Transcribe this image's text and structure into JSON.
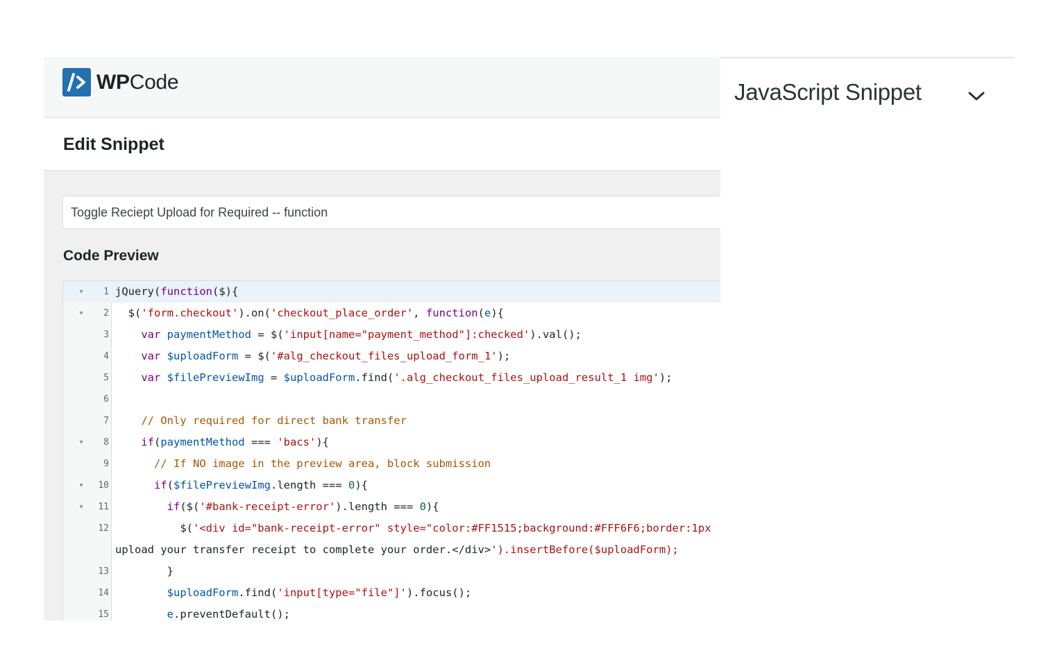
{
  "brand": {
    "name_bold": "WP",
    "name_regular": "Code",
    "accent": "#2271b1"
  },
  "header": {
    "page_title": "Edit Snippet"
  },
  "snippet": {
    "title_value": "Toggle Reciept Upload for Required -- function"
  },
  "code_preview": {
    "label": "Code Preview",
    "lines": [
      {
        "n": "1",
        "fold": "▾",
        "text": "jQuery(function($){"
      },
      {
        "n": "2",
        "fold": "▾",
        "text": "  $('form.checkout').on('checkout_place_order', function(e){"
      },
      {
        "n": "3",
        "fold": "",
        "text": "    var paymentMethod = $('input[name=\"payment_method\"]:checked').val();"
      },
      {
        "n": "4",
        "fold": "",
        "text": "    var $uploadForm = $('#alg_checkout_files_upload_form_1');"
      },
      {
        "n": "5",
        "fold": "",
        "text": "    var $filePreviewImg = $uploadForm.find('.alg_checkout_files_upload_result_1 img');"
      },
      {
        "n": "6",
        "fold": "",
        "text": ""
      },
      {
        "n": "7",
        "fold": "",
        "text": "    // Only required for direct bank transfer"
      },
      {
        "n": "8",
        "fold": "▾",
        "text": "    if(paymentMethod === 'bacs'){"
      },
      {
        "n": "9",
        "fold": "",
        "text": "      // If NO image in the preview area, block submission"
      },
      {
        "n": "10",
        "fold": "▾",
        "text": "      if($filePreviewImg.length === 0){"
      },
      {
        "n": "11",
        "fold": "▾",
        "text": "        if($('#bank-receipt-error').length === 0){"
      },
      {
        "n": "12",
        "fold": "",
        "text": "          $('<div id=\"bank-receipt-error\" style=\"color:#FF1515;background:#FFF6F6;border:1px"
      },
      {
        "n": "",
        "fold": "",
        "text": "upload your transfer receipt to complete your order.</div>').insertBefore($uploadForm);"
      },
      {
        "n": "13",
        "fold": "",
        "text": "        }"
      },
      {
        "n": "14",
        "fold": "",
        "text": "        $uploadForm.find('input[type=\"file\"]').focus();"
      },
      {
        "n": "15",
        "fold": "",
        "text": "        e.preventDefault();"
      }
    ]
  },
  "sidebar": {
    "snippet_type": "JavaScript Snippet",
    "dropdown_icon": "chevron-down-icon"
  }
}
